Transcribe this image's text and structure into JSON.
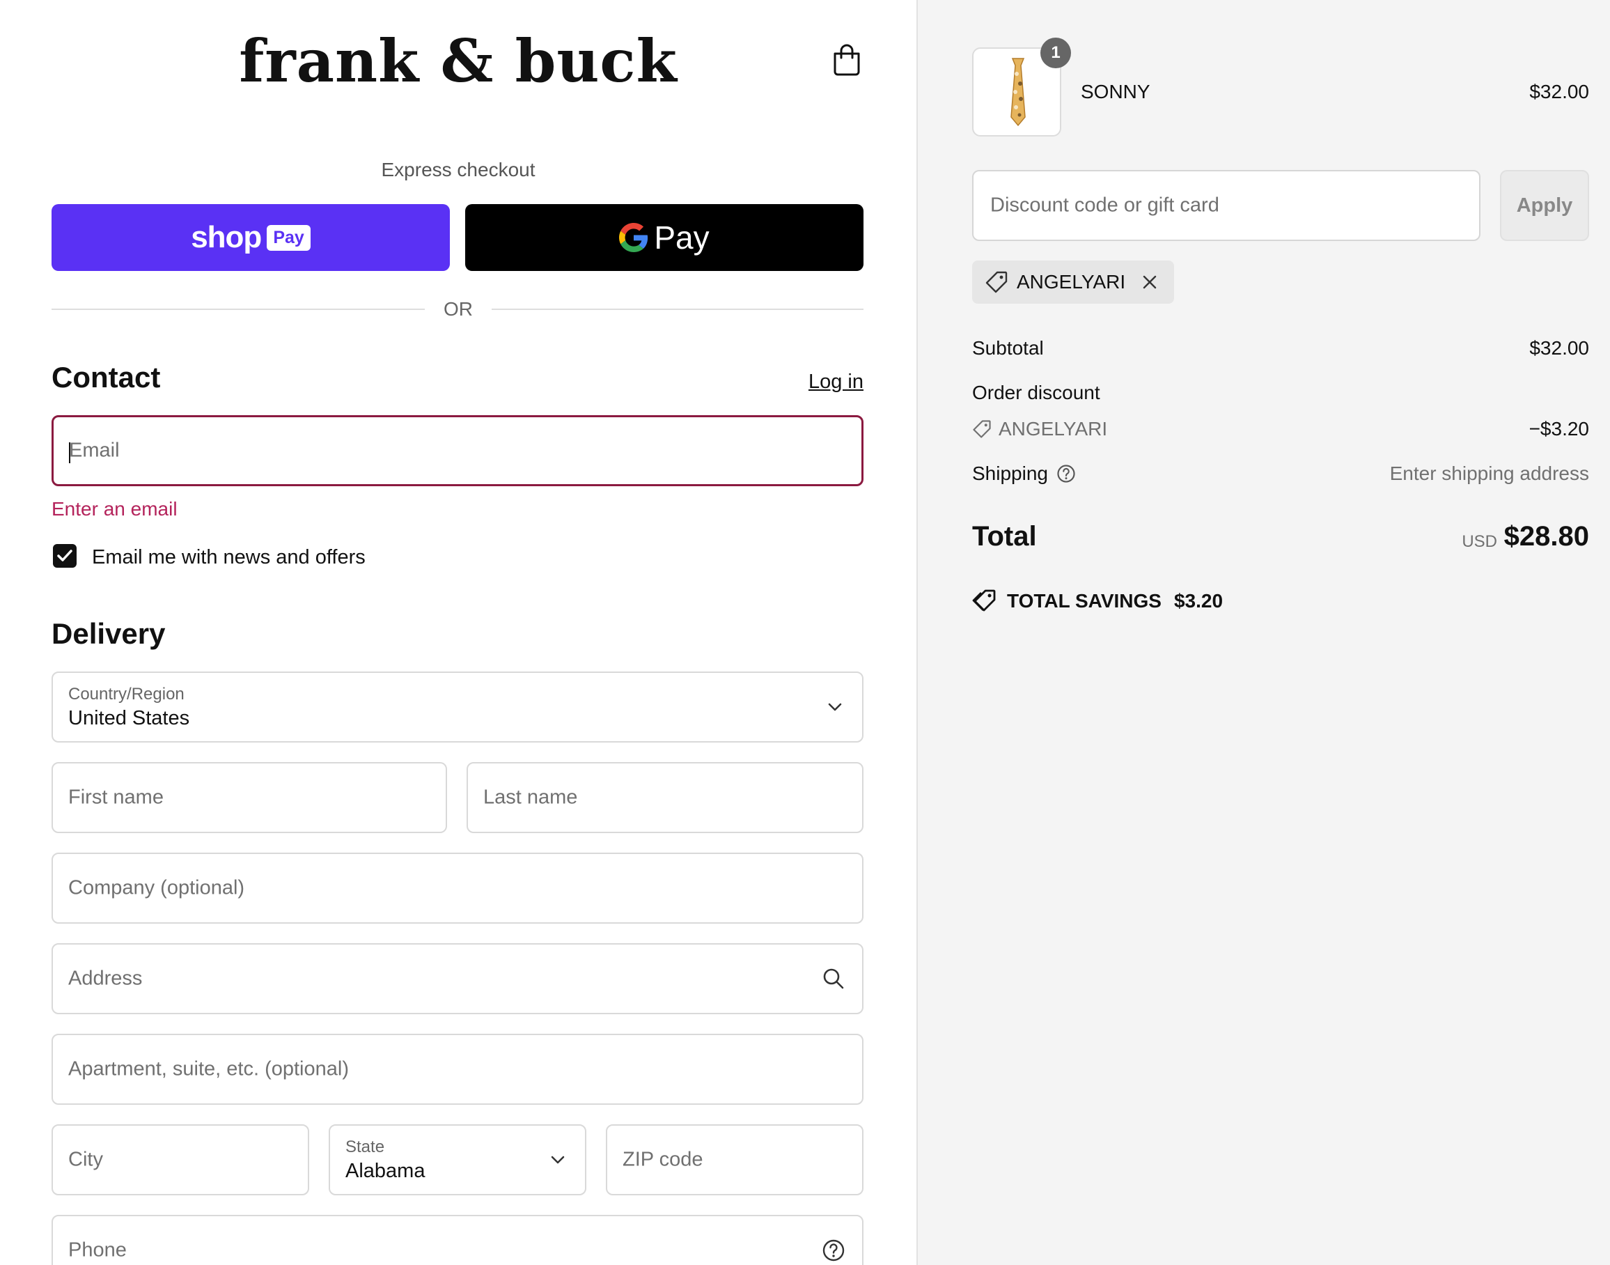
{
  "header": {
    "brand": "frank & buck",
    "cart_icon": "shopping-bag-icon"
  },
  "express": {
    "label": "Express checkout",
    "shop_pay_word": "shop",
    "shop_pay_badge": "Pay",
    "gpay_word": "Pay",
    "divider": "OR"
  },
  "contact": {
    "heading": "Contact",
    "login_link": "Log in",
    "email_placeholder": "Email",
    "email_error": "Enter an email",
    "newsletter_label": "Email me with news and offers",
    "newsletter_checked": true
  },
  "delivery": {
    "heading": "Delivery",
    "country_label": "Country/Region",
    "country_value": "United States",
    "first_name_placeholder": "First name",
    "last_name_placeholder": "Last name",
    "company_placeholder": "Company (optional)",
    "address_placeholder": "Address",
    "apartment_placeholder": "Apartment, suite, etc. (optional)",
    "city_placeholder": "City",
    "state_label": "State",
    "state_value": "Alabama",
    "zip_placeholder": "ZIP code",
    "phone_placeholder": "Phone"
  },
  "summary": {
    "item": {
      "name": "SONNY",
      "price": "$32.00",
      "quantity": "1"
    },
    "discount_placeholder": "Discount code or gift card",
    "apply_label": "Apply",
    "applied_code": "ANGELYARI",
    "subtotal_label": "Subtotal",
    "subtotal_value": "$32.00",
    "order_discount_label": "Order discount",
    "discount_code": "ANGELYARI",
    "discount_value": "−$3.20",
    "shipping_label": "Shipping",
    "shipping_value": "Enter shipping address",
    "total_label": "Total",
    "total_currency": "USD",
    "total_value": "$28.80",
    "savings_label": "TOTAL SAVINGS",
    "savings_value": "$3.20"
  },
  "colors": {
    "shop_pay": "#5a31f4",
    "gpay": "#000000",
    "error": "#b4235b",
    "summary_bg": "#f4f4f4"
  }
}
